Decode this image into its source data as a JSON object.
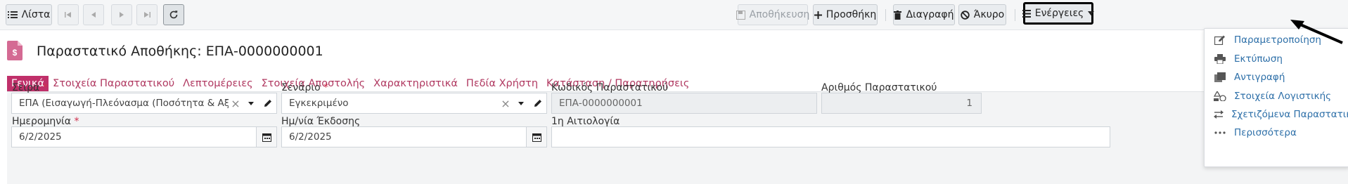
{
  "toolbar": {
    "list_label": "Λίστα",
    "save_label": "Αποθήκευση",
    "add_label": "Προσθήκη",
    "delete_label": "Διαγραφή",
    "cancel_label": "Άκυρο",
    "actions_label": "Ενέργειες"
  },
  "header": {
    "title": "Παραστατικό Αποθήκης: ΕΠΑ-0000000001"
  },
  "tabs": [
    {
      "label": "Γενικά"
    },
    {
      "label": "Στοιχεία Παραστατικού"
    },
    {
      "label": "Λεπτομέρειες"
    },
    {
      "label": "Στοιχεία Αποστολής"
    },
    {
      "label": "Χαρακτηριστικά"
    },
    {
      "label": "Πεδία Χρήστη"
    },
    {
      "label": "Κατάσταση / Παρατηρήσεις"
    }
  ],
  "form": {
    "series": {
      "label": "Σειρά",
      "required_mark": "*",
      "value": "ΕΠΑ (Εισαγωγή-Πλεόνασμα (Ποσότητα & Αξία))"
    },
    "scenario": {
      "label": "Σενάριο",
      "required_mark": "*",
      "value": "Εγκεκριμένο"
    },
    "doc_code": {
      "label": "Κωδικός Παραστατικού",
      "value": "ΕΠΑ-0000000001"
    },
    "doc_number": {
      "label": "Αριθμός Παραστατικού",
      "value": "1"
    },
    "date": {
      "label": "Ημερομηνία",
      "required_mark": "*",
      "value": "6/2/2025"
    },
    "issue_date": {
      "label": "Ημ/νία Έκδοσης",
      "value": "6/2/2025"
    },
    "reason1": {
      "label": "1η Αιτιολογία",
      "value": ""
    }
  },
  "actions_menu": {
    "items": [
      {
        "label": "Παραμετροποίηση",
        "icon": "edit-icon"
      },
      {
        "label": "Εκτύπωση",
        "icon": "print-icon"
      },
      {
        "label": "Αντιγραφή",
        "icon": "copy-icon"
      },
      {
        "label": "Στοιχεία Λογιστικής",
        "icon": "accounting-icon"
      },
      {
        "label": "Σχετιζόμενα Παραστατικά",
        "icon": "exchange-icon"
      },
      {
        "label": "Περισσότερα",
        "icon": "more-icon"
      }
    ]
  },
  "colors": {
    "accent": "#c0306a",
    "link": "#2d6fa8"
  }
}
